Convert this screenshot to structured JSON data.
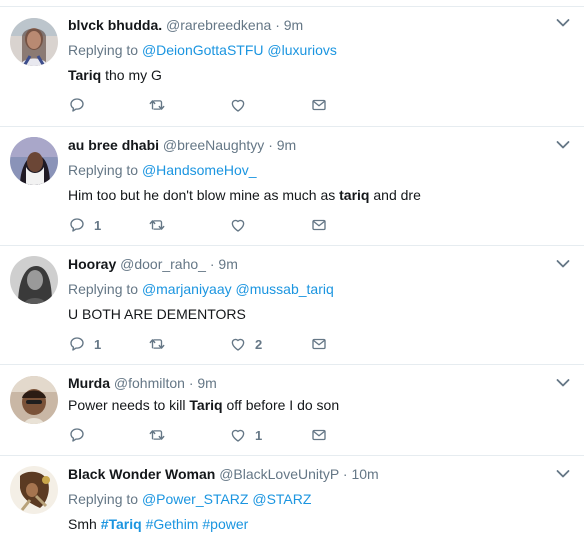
{
  "tweets": [
    {
      "name": "blvck bhudda.",
      "handle": "@rarebreedkena",
      "time": "9m",
      "reply_label": "Replying to",
      "mentions": [
        "@DeionGottaSTFU",
        "@luxuriovs"
      ],
      "text_bold": "Tariq",
      "text_rest": " tho my G",
      "reply_count": "",
      "like_count": ""
    },
    {
      "name": "au bree dhabi",
      "handle": "@breeNaughtyy",
      "time": "9m",
      "reply_label": "Replying to",
      "mentions": [
        "@HandsomeHov_"
      ],
      "text_pre": "Him too but he don't blow mine as much as ",
      "text_bold": "tariq",
      "text_rest": " and dre",
      "reply_count": "1",
      "like_count": ""
    },
    {
      "name": "Hooray",
      "handle": "@door_raho_",
      "time": "9m",
      "reply_label": "Replying to",
      "mentions": [
        "@marjaniyaay",
        "@mussab_tariq"
      ],
      "text": "U BOTH ARE DEMENTORS",
      "reply_count": "1",
      "like_count": "2"
    },
    {
      "name": "Murda",
      "handle": "@fohmilton",
      "time": "9m",
      "text_pre": "Power needs to kill ",
      "text_bold": "Tariq",
      "text_rest": " off before I do son",
      "reply_count": "",
      "like_count": "1"
    },
    {
      "name": "Black Wonder Woman",
      "handle": "@BlackLoveUnityP",
      "time": "10m",
      "reply_label": "Replying to",
      "mentions": [
        "@Power_STARZ",
        "@STARZ"
      ],
      "text_pre": "Smh ",
      "hashtags": [
        "#Tariq",
        "#Gethim",
        "#power"
      ]
    }
  ],
  "separator": "·",
  "colors": {
    "link": "#1b95e0",
    "muted": "#657786",
    "border": "#e6ecf0"
  },
  "icons": [
    "reply-icon",
    "retweet-icon",
    "like-icon",
    "message-icon",
    "caret-down-icon"
  ]
}
